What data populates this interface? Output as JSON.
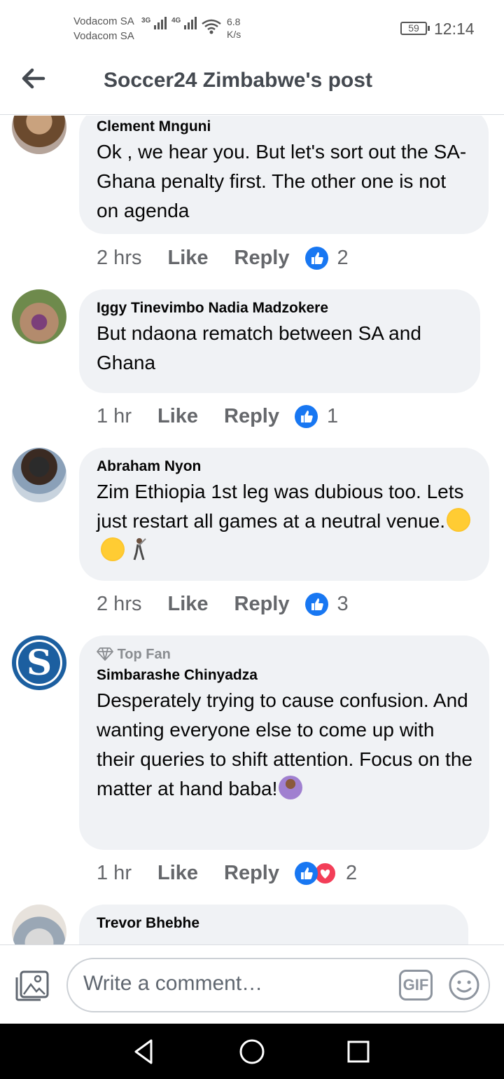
{
  "status_bar": {
    "carrier_1": "Vodacom SA",
    "carrier_2": "Vodacom SA",
    "network_1": "3G",
    "network_2": "4G",
    "speed_value": "6.8",
    "speed_unit": "K/s",
    "battery": "59",
    "time": "12:14"
  },
  "header": {
    "title": "Soccer24 Zimbabwe's post",
    "back_icon": "arrow-left-icon"
  },
  "comments": [
    {
      "author": "Clement Mnguni",
      "text": "Ok , we hear you. But let's sort out the SA- Ghana penalty first. The other one is not on agenda",
      "time": "2 hrs",
      "like_label": "Like",
      "reply_label": "Reply",
      "reaction_count": "2",
      "reactions": [
        "like"
      ]
    },
    {
      "author": "Iggy Tinevimbo Nadia Madzokere",
      "text": "But ndaona rematch between SA and Ghana",
      "time": "1 hr",
      "like_label": "Like",
      "reply_label": "Reply",
      "reaction_count": "1",
      "reactions": [
        "like"
      ]
    },
    {
      "author": "Abraham Nyon",
      "text": "Zim Ethiopia 1st leg was dubious too. Lets just restart all games at a neutral venue.",
      "emojis": [
        "heart-eyes-emoji",
        "smiling-hearts-emoji",
        "golfer-emoji"
      ],
      "time": "2 hrs",
      "like_label": "Like",
      "reply_label": "Reply",
      "reaction_count": "3",
      "reactions": [
        "like"
      ]
    },
    {
      "badge": "Top Fan",
      "author": "Simbarashe Chinyadza",
      "text": "Desperately trying to cause confusion. And wanting everyone else to come up with their queries to shift attention. Focus on the matter at hand baba!",
      "emojis": [
        "person-gesturing-ok-emoji"
      ],
      "time": "1 hr",
      "like_label": "Like",
      "reply_label": "Reply",
      "reaction_count": "2",
      "reactions": [
        "like",
        "love"
      ]
    },
    {
      "author": "Trevor Bhebhe"
    }
  ],
  "composer": {
    "placeholder": "Write a comment…",
    "gif_label": "GIF"
  },
  "colors": {
    "like_blue": "#1877f2",
    "love_red": "#f33e58",
    "bubble_gray": "#f0f2f5"
  }
}
